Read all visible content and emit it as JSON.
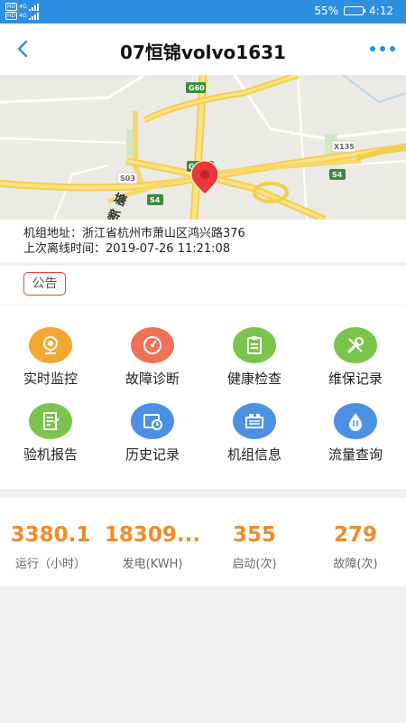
{
  "status_bar": {
    "left_indicators": [
      {
        "badge": "HD",
        "network": "4G"
      },
      {
        "badge": "HD",
        "network": "4G"
      }
    ],
    "battery_text": "55%",
    "battery_level": 0.55,
    "time": "4:12"
  },
  "header": {
    "title": "07恒锦volvo1631",
    "back_icon": "back-chevron-icon",
    "more_icon": "more-dots-icon"
  },
  "map": {
    "road_labels": [
      "G60",
      "G2501",
      "S03",
      "S4",
      "S4",
      "X135",
      "塘",
      "新"
    ],
    "marker_icon": "location-pin-icon"
  },
  "info": {
    "address_label": "机组地址：",
    "address_value": "浙江省杭州市萧山区鸿兴路376",
    "offline_label": "上次离线时间：",
    "offline_value": "2019-07-26 11:21:08"
  },
  "notice": {
    "label": "公告"
  },
  "menu": [
    {
      "label": "实时监控",
      "icon": "camera-icon",
      "color": "#f1a732"
    },
    {
      "label": "故障诊断",
      "icon": "gauge-icon",
      "color": "#ee7158"
    },
    {
      "label": "健康检查",
      "icon": "clipboard-icon",
      "color": "#7ac44c"
    },
    {
      "label": "维保记录",
      "icon": "wrench-icon",
      "color": "#7ac44c"
    },
    {
      "label": "验机报告",
      "icon": "report-icon",
      "color": "#7ac44c"
    },
    {
      "label": "历史记录",
      "icon": "history-icon",
      "color": "#4b90e3"
    },
    {
      "label": "机组信息",
      "icon": "machine-icon",
      "color": "#4b90e3"
    },
    {
      "label": "流量查询",
      "icon": "data-flow-icon",
      "color": "#4b90e3"
    }
  ],
  "stats": [
    {
      "value": "3380.1",
      "label": "运行（小时）"
    },
    {
      "value": "18309...",
      "label": "发电(KWH)"
    },
    {
      "value": "355",
      "label": "启动(次)"
    },
    {
      "value": "279",
      "label": "故障(次)"
    }
  ],
  "colors": {
    "primary": "#2f8fe0",
    "accent": "#ef8c28",
    "alert": "#e0463c",
    "background": "#efefef"
  }
}
